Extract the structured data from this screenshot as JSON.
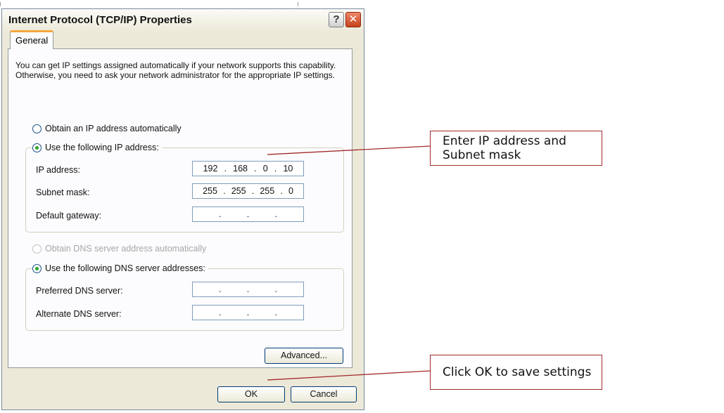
{
  "dialog": {
    "title": "Internet Protocol (TCP/IP) Properties",
    "help_icon": "?",
    "close_icon": "✕",
    "tabs": [
      {
        "label": "General"
      }
    ],
    "description": "You can get IP settings assigned automatically if your network supports this capability. Otherwise, you need to ask your network administrator for the appropriate IP settings.",
    "ip_section": {
      "auto_option": "Obtain an IP address automatically",
      "manual_option": "Use the following IP address:",
      "fields": [
        {
          "label": "IP address:",
          "octets": [
            "192",
            "168",
            "0",
            "10"
          ]
        },
        {
          "label": "Subnet mask:",
          "octets": [
            "255",
            "255",
            "255",
            "0"
          ]
        },
        {
          "label": "Default gateway:",
          "octets": [
            "",
            "",
            "",
            ""
          ]
        }
      ]
    },
    "dns_section": {
      "auto_option": "Obtain DNS server address automatically",
      "manual_option": "Use the following DNS server addresses:",
      "fields": [
        {
          "label": "Preferred DNS server:",
          "octets": [
            "",
            "",
            "",
            ""
          ]
        },
        {
          "label": "Alternate DNS server:",
          "octets": [
            "",
            "",
            "",
            ""
          ]
        }
      ]
    },
    "buttons": {
      "advanced": "Advanced...",
      "ok": "OK",
      "cancel": "Cancel"
    }
  },
  "callouts": {
    "ip_mask": "Enter IP address and Subnet mask",
    "ok_save": "Click OK to save settings"
  },
  "colors": {
    "callout_border": "#a32b2b",
    "radio_selected": "#2aa52a",
    "tab_accent": "#f4a73c",
    "close_button": "#c4421c"
  }
}
